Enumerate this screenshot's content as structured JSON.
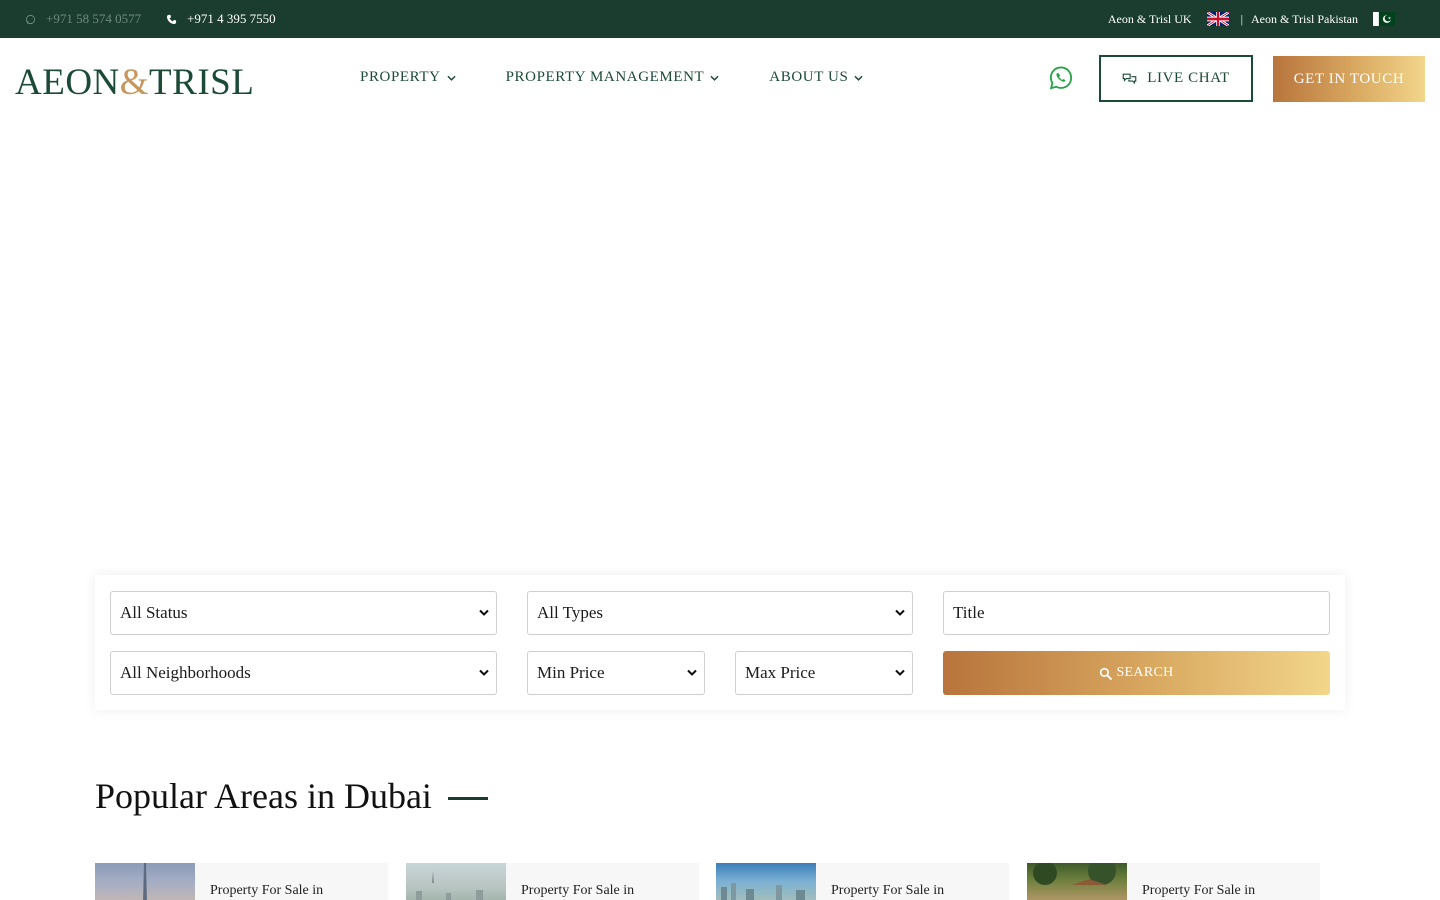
{
  "topbar": {
    "whatsapp_number": "+971 58 574 0577",
    "phone_number": "+971 4 395 7550",
    "uk_link": "Aeon & Trisl UK",
    "separator": "|",
    "pakistan_link": "Aeon & Trisl Pakistan"
  },
  "header": {
    "logo_left": "AEON",
    "logo_amp": "&",
    "logo_right": "TRISL",
    "nav": [
      {
        "label": "PROPERTY"
      },
      {
        "label": "PROPERTY MANAGEMENT"
      },
      {
        "label": "ABOUT US"
      }
    ],
    "live_chat_label": "LIVE CHAT",
    "get_in_touch_label": "GET IN TOUCH"
  },
  "search": {
    "status": "All Status",
    "types": "All Types",
    "title_placeholder": "Title",
    "neighborhoods": "All Neighborhoods",
    "min_price": "Min Price",
    "max_price": "Max Price",
    "search_label": "SEARCH"
  },
  "popular": {
    "title": "Popular Areas in Dubai",
    "cards": [
      {
        "label": "Property For Sale in"
      },
      {
        "label": "Property For Sale in"
      },
      {
        "label": "Property For Sale in"
      },
      {
        "label": "Property For Sale in"
      }
    ]
  },
  "colors": {
    "topbar_bg": "#1b3d2f",
    "brand_green": "#1b4a37",
    "gold_start": "#b8743c",
    "gold_end": "#f2d68a",
    "whatsapp_green": "#25d366"
  }
}
